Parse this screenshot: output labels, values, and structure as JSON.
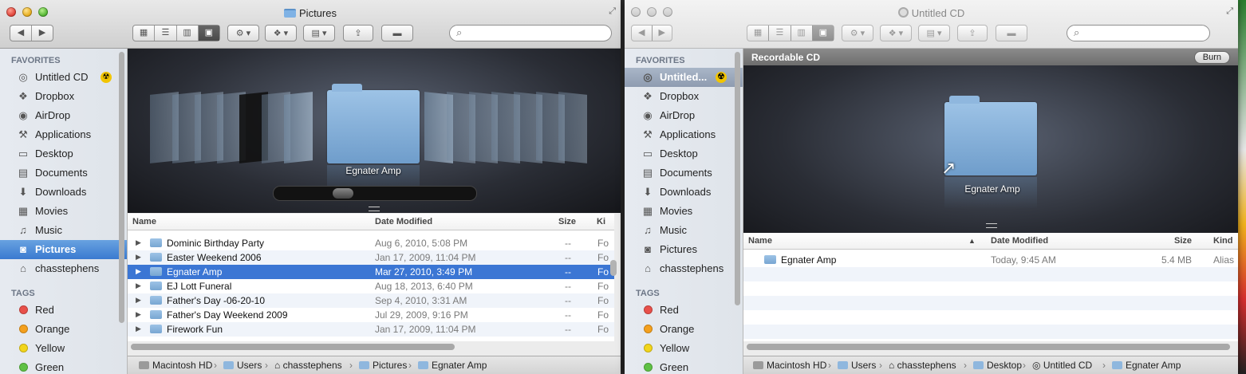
{
  "windows": [
    {
      "title": "Pictures",
      "sidebar": {
        "favorites_header": "FAVORITES",
        "favorites": [
          {
            "label": "Untitled CD",
            "icon": "cd-icon"
          },
          {
            "label": "Dropbox",
            "icon": "dropbox-icon"
          },
          {
            "label": "AirDrop",
            "icon": "airdrop-icon"
          },
          {
            "label": "Applications",
            "icon": "applications-icon"
          },
          {
            "label": "Desktop",
            "icon": "desktop-icon"
          },
          {
            "label": "Documents",
            "icon": "documents-icon"
          },
          {
            "label": "Downloads",
            "icon": "downloads-icon"
          },
          {
            "label": "Movies",
            "icon": "movies-icon"
          },
          {
            "label": "Music",
            "icon": "music-icon"
          },
          {
            "label": "Pictures",
            "icon": "camera-icon",
            "selected": true
          },
          {
            "label": "chasstephens",
            "icon": "home-icon"
          }
        ],
        "tags_header": "TAGS",
        "tags": [
          {
            "label": "Red",
            "color": "#e8504a"
          },
          {
            "label": "Orange",
            "color": "#f4a01d"
          },
          {
            "label": "Yellow",
            "color": "#f2d51b"
          },
          {
            "label": "Green",
            "color": "#5fc144"
          }
        ]
      },
      "coverflow_label": "Egnater Amp",
      "columns": {
        "name": "Name",
        "date": "Date Modified",
        "size": "Size",
        "kind": "Ki"
      },
      "rows": [
        {
          "name": "Dominic Birthday Party",
          "date": "Aug 6, 2010, 5:08 PM",
          "size": "--",
          "kind": "Fo"
        },
        {
          "name": "Easter Weekend 2006",
          "date": "Jan 17, 2009, 11:04 PM",
          "size": "--",
          "kind": "Fo"
        },
        {
          "name": "Egnater Amp",
          "date": "Mar 27, 2010, 3:49 PM",
          "size": "--",
          "kind": "Fo",
          "selected": true
        },
        {
          "name": "EJ Lott Funeral",
          "date": "Aug 18, 2013, 6:40 PM",
          "size": "--",
          "kind": "Fo"
        },
        {
          "name": "Father's Day -06-20-10",
          "date": "Sep 4, 2010, 3:31 AM",
          "size": "--",
          "kind": "Fo"
        },
        {
          "name": "Father's Day Weekend 2009",
          "date": "Jul 29, 2009, 9:16 PM",
          "size": "--",
          "kind": "Fo"
        },
        {
          "name": "Firework Fun",
          "date": "Jan 17, 2009, 11:04 PM",
          "size": "--",
          "kind": "Fo"
        }
      ],
      "path": [
        "Macintosh HD",
        "Users",
        "chasstephens",
        "Pictures",
        "Egnater Amp"
      ]
    },
    {
      "title": "Untitled CD",
      "sidebar": {
        "favorites_header": "FAVORITES",
        "favorites": [
          {
            "label": "Untitled...",
            "icon": "cd-icon",
            "selected": true
          },
          {
            "label": "Dropbox",
            "icon": "dropbox-icon"
          },
          {
            "label": "AirDrop",
            "icon": "airdrop-icon"
          },
          {
            "label": "Applications",
            "icon": "applications-icon"
          },
          {
            "label": "Desktop",
            "icon": "desktop-icon"
          },
          {
            "label": "Documents",
            "icon": "documents-icon"
          },
          {
            "label": "Downloads",
            "icon": "downloads-icon"
          },
          {
            "label": "Movies",
            "icon": "movies-icon"
          },
          {
            "label": "Music",
            "icon": "music-icon"
          },
          {
            "label": "Pictures",
            "icon": "camera-icon"
          },
          {
            "label": "chasstephens",
            "icon": "home-icon"
          }
        ],
        "tags_header": "TAGS",
        "tags": [
          {
            "label": "Red",
            "color": "#e8504a"
          },
          {
            "label": "Orange",
            "color": "#f4a01d"
          },
          {
            "label": "Yellow",
            "color": "#f2d51b"
          },
          {
            "label": "Green",
            "color": "#5fc144"
          }
        ]
      },
      "banner_title": "Recordable CD",
      "burn_label": "Burn",
      "coverflow_label": "Egnater Amp",
      "columns": {
        "name": "Name",
        "date": "Date Modified",
        "size": "Size",
        "kind": "Kind"
      },
      "rows": [
        {
          "name": "Egnater Amp",
          "date": "Today, 9:45 AM",
          "size": "5.4 MB",
          "kind": "Alias"
        }
      ],
      "path": [
        "Macintosh HD",
        "Users",
        "chasstephens",
        "Desktop",
        "Untitled CD",
        "Egnater Amp"
      ]
    }
  ]
}
